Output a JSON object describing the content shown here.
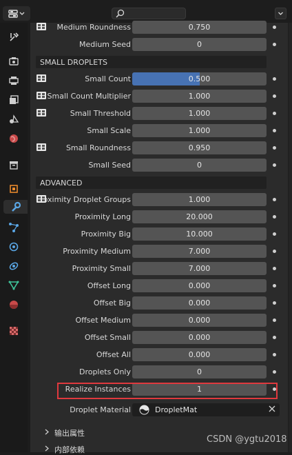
{
  "search": {
    "placeholder": ""
  },
  "rows_top": [
    {
      "label": "Medium Roundness",
      "value": "0.750",
      "node": true
    },
    {
      "label": "Medium Seed",
      "value": "0",
      "node": false
    }
  ],
  "section_small": "SMALL DROPLETS",
  "rows_small": [
    {
      "label": "Small Count",
      "value": "0.500",
      "node": true,
      "fill": 0.5
    },
    {
      "label": "Small Count Multiplier",
      "value": "1.000",
      "node": true
    },
    {
      "label": "Small Threshold",
      "value": "1.000",
      "node": true
    },
    {
      "label": "Small Scale",
      "value": "1.000",
      "node": false
    },
    {
      "label": "Small Roundness",
      "value": "0.950",
      "node": true
    },
    {
      "label": "Small Seed",
      "value": "0",
      "node": false
    }
  ],
  "section_advanced": "ADVANCED",
  "rows_advanced": [
    {
      "label": "Proximity Droplet Groups",
      "value": "1.000",
      "node": true
    },
    {
      "label": "Proximity Long",
      "value": "20.000",
      "node": false
    },
    {
      "label": "Proximity Big",
      "value": "10.000",
      "node": false
    },
    {
      "label": "Proximity Medium",
      "value": "7.000",
      "node": false
    },
    {
      "label": "Proximity Small",
      "value": "7.000",
      "node": false
    },
    {
      "label": "Offset Long",
      "value": "0.000",
      "node": false
    },
    {
      "label": "Offset Big",
      "value": "0.000",
      "node": false
    },
    {
      "label": "Offset Medium",
      "value": "0.000",
      "node": false
    },
    {
      "label": "Offset Small",
      "value": "0.000",
      "node": false
    },
    {
      "label": "Offset All",
      "value": "0.000",
      "node": false
    },
    {
      "label": "Droplets Only",
      "value": "0",
      "node": false
    },
    {
      "label": "Realize Instances",
      "value": "1",
      "node": false
    }
  ],
  "material": {
    "label": "Droplet Material",
    "value": "DropletMat"
  },
  "panels": [
    "输出属性",
    "内部依赖"
  ],
  "watermark": "CSDN @ygtu2018",
  "colors": {
    "accent": "#4772b3",
    "highlight": "#e0393e"
  },
  "sidebar_icons": [
    "tool-icon",
    "render-icon",
    "output-icon",
    "view-layer-icon",
    "scene-icon",
    "world-icon",
    "collection-icon",
    "object-icon",
    "modifier-icon",
    "particles-icon",
    "physics-icon",
    "constraints-icon",
    "data-icon",
    "material-icon",
    "texture-icon"
  ]
}
